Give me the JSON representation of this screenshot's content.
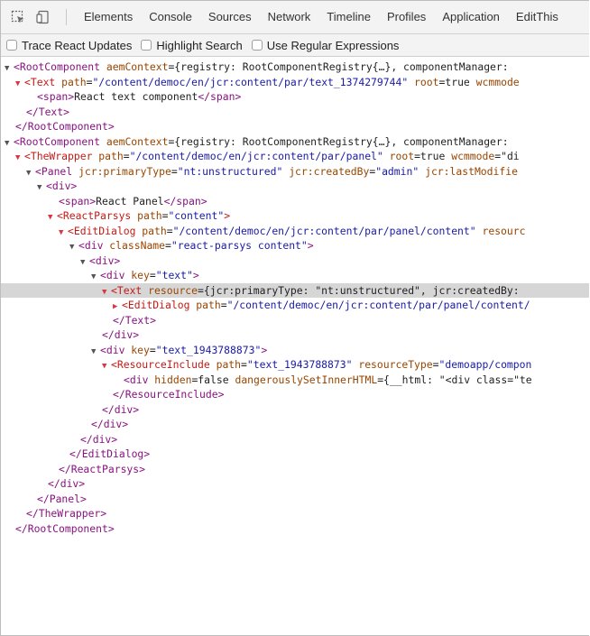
{
  "toolbar": {
    "tabs": [
      "Elements",
      "Console",
      "Sources",
      "Network",
      "Timeline",
      "Profiles",
      "Application",
      "EditThis"
    ]
  },
  "react_bar": {
    "options": [
      "Trace React Updates",
      "Highlight Search",
      "Use Regular Expressions"
    ]
  },
  "tree_lines": [
    {
      "indent": 0,
      "tri": "▼",
      "tri_red": false,
      "parts": [
        [
          "tag",
          "<RootComponent "
        ],
        [
          "attr",
          "aemContext"
        ],
        [
          "txt",
          "={registry: RootComponentRegistry{…}, componentManager:"
        ]
      ]
    },
    {
      "indent": 1,
      "tri": "▼",
      "tri_red": true,
      "parts": [
        [
          "tag",
          "<Text "
        ],
        [
          "attr",
          "path"
        ],
        [
          "txt",
          "="
        ],
        [
          "val",
          "\"/content/democ/en/jcr:content/par/text_1374279744\""
        ],
        [
          "attr",
          " root"
        ],
        [
          "txt",
          "=true "
        ],
        [
          "attr",
          "wcmmode"
        ]
      ]
    },
    {
      "indent": 3,
      "tri": "",
      "tri_red": false,
      "parts": [
        [
          "tag",
          "<span>"
        ],
        [
          "txt",
          "React text component"
        ],
        [
          "tag",
          "</span>"
        ]
      ]
    },
    {
      "indent": 2,
      "tri": "",
      "tri_red": false,
      "parts": [
        [
          "tag",
          "</Text>"
        ]
      ]
    },
    {
      "indent": 1,
      "tri": "",
      "tri_red": false,
      "parts": [
        [
          "tag",
          "</RootComponent>"
        ]
      ]
    },
    {
      "indent": 0,
      "tri": "▼",
      "tri_red": false,
      "parts": [
        [
          "tag",
          "<RootComponent "
        ],
        [
          "attr",
          "aemContext"
        ],
        [
          "txt",
          "={registry: RootComponentRegistry{…}, componentManager:"
        ]
      ]
    },
    {
      "indent": 1,
      "tri": "▼",
      "tri_red": true,
      "parts": [
        [
          "tag",
          "<TheWrapper "
        ],
        [
          "attr",
          "path"
        ],
        [
          "txt",
          "="
        ],
        [
          "val",
          "\"/content/democ/en/jcr:content/par/panel\""
        ],
        [
          "attr",
          " root"
        ],
        [
          "txt",
          "=true "
        ],
        [
          "attr",
          "wcmmode"
        ],
        [
          "txt",
          "=\"di"
        ]
      ]
    },
    {
      "indent": 2,
      "tri": "▼",
      "tri_red": false,
      "parts": [
        [
          "tag",
          "<Panel "
        ],
        [
          "attr",
          "jcr:primaryType"
        ],
        [
          "txt",
          "="
        ],
        [
          "val",
          "\"nt:unstructured\""
        ],
        [
          "attr",
          " jcr:createdBy"
        ],
        [
          "txt",
          "="
        ],
        [
          "val",
          "\"admin\""
        ],
        [
          "attr",
          " jcr:lastModifie"
        ]
      ]
    },
    {
      "indent": 3,
      "tri": "▼",
      "tri_red": false,
      "parts": [
        [
          "tag",
          "<div>"
        ]
      ]
    },
    {
      "indent": 5,
      "tri": "",
      "tri_red": false,
      "parts": [
        [
          "tag",
          "<span>"
        ],
        [
          "txt",
          "React Panel"
        ],
        [
          "tag",
          "</span>"
        ]
      ]
    },
    {
      "indent": 4,
      "tri": "▼",
      "tri_red": true,
      "parts": [
        [
          "tag",
          "<ReactParsys "
        ],
        [
          "attr",
          "path"
        ],
        [
          "txt",
          "="
        ],
        [
          "val",
          "\"content\""
        ],
        [
          "tag",
          ">"
        ]
      ]
    },
    {
      "indent": 5,
      "tri": "▼",
      "tri_red": true,
      "parts": [
        [
          "tag",
          "<EditDialog "
        ],
        [
          "attr",
          "path"
        ],
        [
          "txt",
          "="
        ],
        [
          "val",
          "\"/content/democ/en/jcr:content/par/panel/content\""
        ],
        [
          "attr",
          " resourc"
        ]
      ]
    },
    {
      "indent": 6,
      "tri": "▼",
      "tri_red": false,
      "parts": [
        [
          "tag",
          "<div "
        ],
        [
          "attr",
          "className"
        ],
        [
          "txt",
          "="
        ],
        [
          "val",
          "\"react-parsys content\""
        ],
        [
          "tag",
          ">"
        ]
      ]
    },
    {
      "indent": 7,
      "tri": "▼",
      "tri_red": false,
      "parts": [
        [
          "tag",
          "<div>"
        ]
      ]
    },
    {
      "indent": 8,
      "tri": "▼",
      "tri_red": false,
      "parts": [
        [
          "tag",
          "<div "
        ],
        [
          "attr",
          "key"
        ],
        [
          "txt",
          "="
        ],
        [
          "val",
          "\"text\""
        ],
        [
          "tag",
          ">"
        ]
      ]
    },
    {
      "indent": 9,
      "tri": "▼",
      "tri_red": true,
      "sel": true,
      "parts": [
        [
          "tag",
          "<Text "
        ],
        [
          "attr",
          "resource"
        ],
        [
          "txt",
          "={jcr:primaryType: \"nt:unstructured\", jcr:createdBy:"
        ]
      ]
    },
    {
      "indent": 10,
      "tri": "▶",
      "tri_red": true,
      "parts": [
        [
          "tag",
          "<EditDialog "
        ],
        [
          "attr",
          "path"
        ],
        [
          "txt",
          "="
        ],
        [
          "val",
          "\"/content/democ/en/jcr:content/par/panel/content/"
        ]
      ]
    },
    {
      "indent": 10,
      "tri": "",
      "tri_red": false,
      "parts": [
        [
          "tag",
          "</Text>"
        ]
      ]
    },
    {
      "indent": 9,
      "tri": "",
      "tri_red": false,
      "parts": [
        [
          "tag",
          "</div>"
        ]
      ]
    },
    {
      "indent": 8,
      "tri": "▼",
      "tri_red": false,
      "parts": [
        [
          "tag",
          "<div "
        ],
        [
          "attr",
          "key"
        ],
        [
          "txt",
          "="
        ],
        [
          "val",
          "\"text_1943788873\""
        ],
        [
          "tag",
          ">"
        ]
      ]
    },
    {
      "indent": 9,
      "tri": "▼",
      "tri_red": true,
      "parts": [
        [
          "tag",
          "<ResourceInclude "
        ],
        [
          "attr",
          "path"
        ],
        [
          "txt",
          "="
        ],
        [
          "val",
          "\"text_1943788873\""
        ],
        [
          "attr",
          " resourceType"
        ],
        [
          "txt",
          "="
        ],
        [
          "val",
          "\"demoapp/compon"
        ]
      ]
    },
    {
      "indent": 11,
      "tri": "",
      "tri_red": false,
      "parts": [
        [
          "tag",
          "<div "
        ],
        [
          "attr",
          "hidden"
        ],
        [
          "txt",
          "=false "
        ],
        [
          "attr",
          "dangerouslySetInnerHTML"
        ],
        [
          "txt",
          "={__html: \"<div class=\"te"
        ]
      ]
    },
    {
      "indent": 10,
      "tri": "",
      "tri_red": false,
      "parts": [
        [
          "tag",
          "</ResourceInclude>"
        ]
      ]
    },
    {
      "indent": 9,
      "tri": "",
      "tri_red": false,
      "parts": [
        [
          "tag",
          "</div>"
        ]
      ]
    },
    {
      "indent": 8,
      "tri": "",
      "tri_red": false,
      "parts": [
        [
          "tag",
          "</div>"
        ]
      ]
    },
    {
      "indent": 7,
      "tri": "",
      "tri_red": false,
      "parts": [
        [
          "tag",
          "</div>"
        ]
      ]
    },
    {
      "indent": 6,
      "tri": "",
      "tri_red": false,
      "parts": [
        [
          "tag",
          "</EditDialog>"
        ]
      ]
    },
    {
      "indent": 5,
      "tri": "",
      "tri_red": false,
      "parts": [
        [
          "tag",
          "</ReactParsys>"
        ]
      ]
    },
    {
      "indent": 4,
      "tri": "",
      "tri_red": false,
      "parts": [
        [
          "tag",
          "</div>"
        ]
      ]
    },
    {
      "indent": 3,
      "tri": "",
      "tri_red": false,
      "parts": [
        [
          "tag",
          "</Panel>"
        ]
      ]
    },
    {
      "indent": 2,
      "tri": "",
      "tri_red": false,
      "parts": [
        [
          "tag",
          "</TheWrapper>"
        ]
      ]
    },
    {
      "indent": 1,
      "tri": "",
      "tri_red": false,
      "parts": [
        [
          "tag",
          "</RootComponent>"
        ]
      ]
    }
  ]
}
